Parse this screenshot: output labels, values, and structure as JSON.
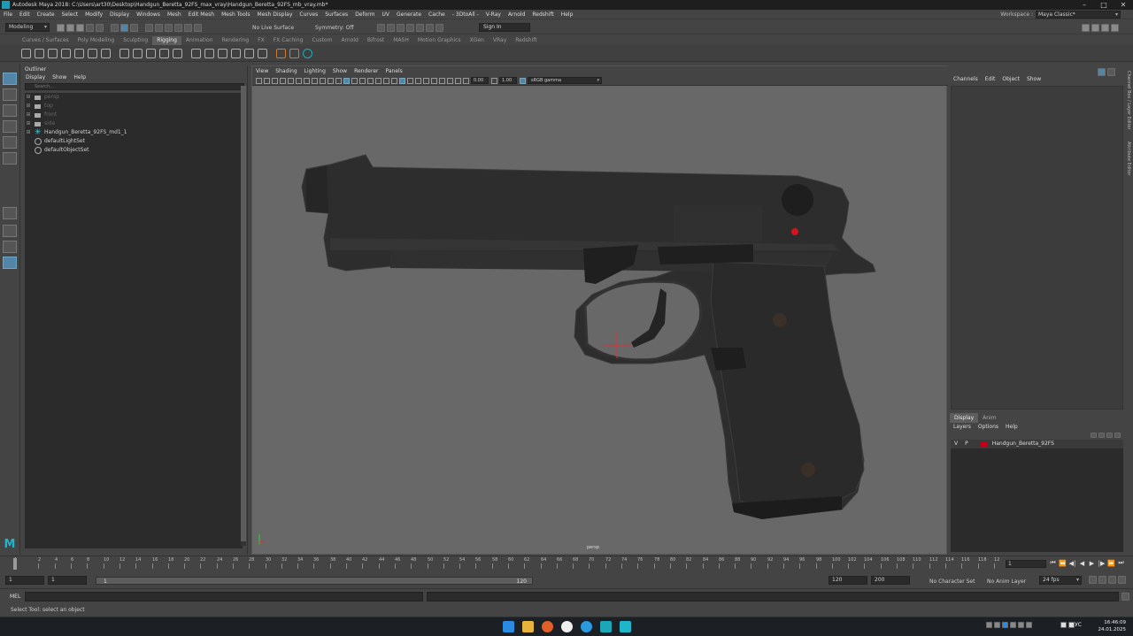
{
  "window": {
    "title": "Autodesk Maya 2018: C:\\Users\\art30\\Desktop\\Handgun_Beretta_92FS_max_vray\\Handgun_Beretta_92FS_mb_vray.mb*",
    "minimize": "–",
    "maximize": "□",
    "close": "✕"
  },
  "menus": [
    "File",
    "Edit",
    "Create",
    "Select",
    "Modify",
    "Display",
    "Windows",
    "Mesh",
    "Edit Mesh",
    "Mesh Tools",
    "Mesh Display",
    "Curves",
    "Surfaces",
    "Deform",
    "UV",
    "Generate",
    "Cache",
    "- 3DtoAll -",
    "V-Ray",
    "Arnold",
    "Redshift",
    "Help"
  ],
  "workspace": {
    "label": "Workspace :",
    "value": "Maya Classic*"
  },
  "status": {
    "mode": "Modeling",
    "live_surface": "No Live Surface",
    "symmetry": "Symmetry: Off",
    "sign_in": "Sign In"
  },
  "shelf_tabs": [
    "Curves / Surfaces",
    "Poly Modeling",
    "Sculpting",
    "Rigging",
    "Animation",
    "Rendering",
    "FX",
    "FX Caching",
    "Custom",
    "Arnold",
    "Bifrost",
    "MASH",
    "Motion Graphics",
    "XGen",
    "VRay",
    "Redshift"
  ],
  "shelf_active": "Rigging",
  "outliner": {
    "title": "Outliner",
    "menu": [
      "Display",
      "Show",
      "Help"
    ],
    "search_placeholder": "Search...",
    "items": [
      {
        "label": "persp",
        "dim": true,
        "type": "camera"
      },
      {
        "label": "top",
        "dim": true,
        "type": "camera"
      },
      {
        "label": "front",
        "dim": true,
        "type": "camera"
      },
      {
        "label": "side",
        "dim": true,
        "type": "camera"
      },
      {
        "label": "Handgun_Beretta_92FS_md1_1",
        "dim": false,
        "type": "joint"
      },
      {
        "label": "defaultLightSet",
        "dim": false,
        "type": "set"
      },
      {
        "label": "defaultObjectSet",
        "dim": false,
        "type": "set"
      }
    ]
  },
  "viewport": {
    "menu": [
      "View",
      "Shading",
      "Lighting",
      "Show",
      "Renderer",
      "Panels"
    ],
    "exposure": "0.00",
    "gamma": "1.00",
    "color_space": "sRGB gamma",
    "camera_label": "persp"
  },
  "channel_box": {
    "menu": [
      "Channels",
      "Edit",
      "Object",
      "Show"
    ]
  },
  "side_tabs": [
    "Channel Box / Layer Editor",
    "Attribute Editor"
  ],
  "layer_editor": {
    "tabs": [
      "Display",
      "Anim"
    ],
    "menu": [
      "Layers",
      "Options",
      "Help"
    ],
    "layers": [
      {
        "v": "V",
        "p": "P",
        "name": "Handgun_Beretta_92FS",
        "color": "#c00018"
      }
    ]
  },
  "time_slider": {
    "ticks": [
      "1",
      "2",
      "4",
      "6",
      "8",
      "10",
      "12",
      "14",
      "16",
      "18",
      "20",
      "22",
      "24",
      "26",
      "28",
      "30",
      "32",
      "34",
      "36",
      "38",
      "40",
      "42",
      "44",
      "46",
      "48",
      "50",
      "52",
      "54",
      "56",
      "58",
      "60",
      "62",
      "64",
      "66",
      "68",
      "70",
      "72",
      "74",
      "76",
      "78",
      "80",
      "82",
      "84",
      "86",
      "88",
      "90",
      "92",
      "94",
      "96",
      "98",
      "100",
      "102",
      "104",
      "106",
      "108",
      "110",
      "112",
      "114",
      "116",
      "118",
      "12"
    ],
    "current_frame": "1"
  },
  "range": {
    "start_outer": "1",
    "start_inner": "1",
    "slider_start": "1",
    "slider_end": "120",
    "end_inner": "120",
    "end_outer": "200",
    "character_set": "No Character Set",
    "anim_layer": "No Anim Layer",
    "fps": "24 fps"
  },
  "command": {
    "label": "MEL"
  },
  "help_line": "Select Tool: select an object",
  "taskbar": {
    "lang": "РУС",
    "time": "16:46:09",
    "date": "24.01.2025"
  }
}
